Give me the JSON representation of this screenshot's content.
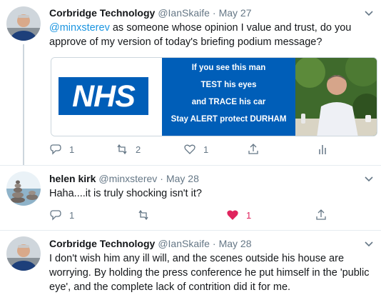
{
  "tweets": [
    {
      "name": "Corbridge Technology",
      "handle": "@IanSkaife",
      "sep": "·",
      "time": "May 27",
      "mention": "@minxsterev",
      "text": " as someone whose opinion I value and trust, do you approve of my version of today's briefing podium message?",
      "media": {
        "logo_text": "NHS",
        "lines": [
          "If you see this man",
          "TEST his eyes",
          "and TRACE his car",
          "Stay ALERT protect DURHAM"
        ]
      },
      "actions": {
        "replies": "1",
        "retweets": "2",
        "likes": "1"
      }
    },
    {
      "name": "helen kirk",
      "handle": "@minxsterev",
      "sep": "·",
      "time": "May 28",
      "text": "Haha....it is truly shocking isn't it?",
      "actions": {
        "replies": "1",
        "retweets": "",
        "likes": "1"
      }
    },
    {
      "name": "Corbridge Technology",
      "handle": "@IanSkaife",
      "sep": "·",
      "time": "May 28",
      "text": "I don't wish him any ill will, and the scenes outside his house are worrying. By holding the press conference he put himself in the 'public eye', and the complete lack of contrition did it for me."
    }
  ],
  "colors": {
    "accent": "#1b95e0",
    "like": "#e0245e",
    "nhs_blue": "#005eb8",
    "muted": "#657786"
  },
  "icons": [
    "reply-icon",
    "retweet-icon",
    "heart-icon",
    "share-icon",
    "analytics-icon",
    "caret-down-icon"
  ]
}
